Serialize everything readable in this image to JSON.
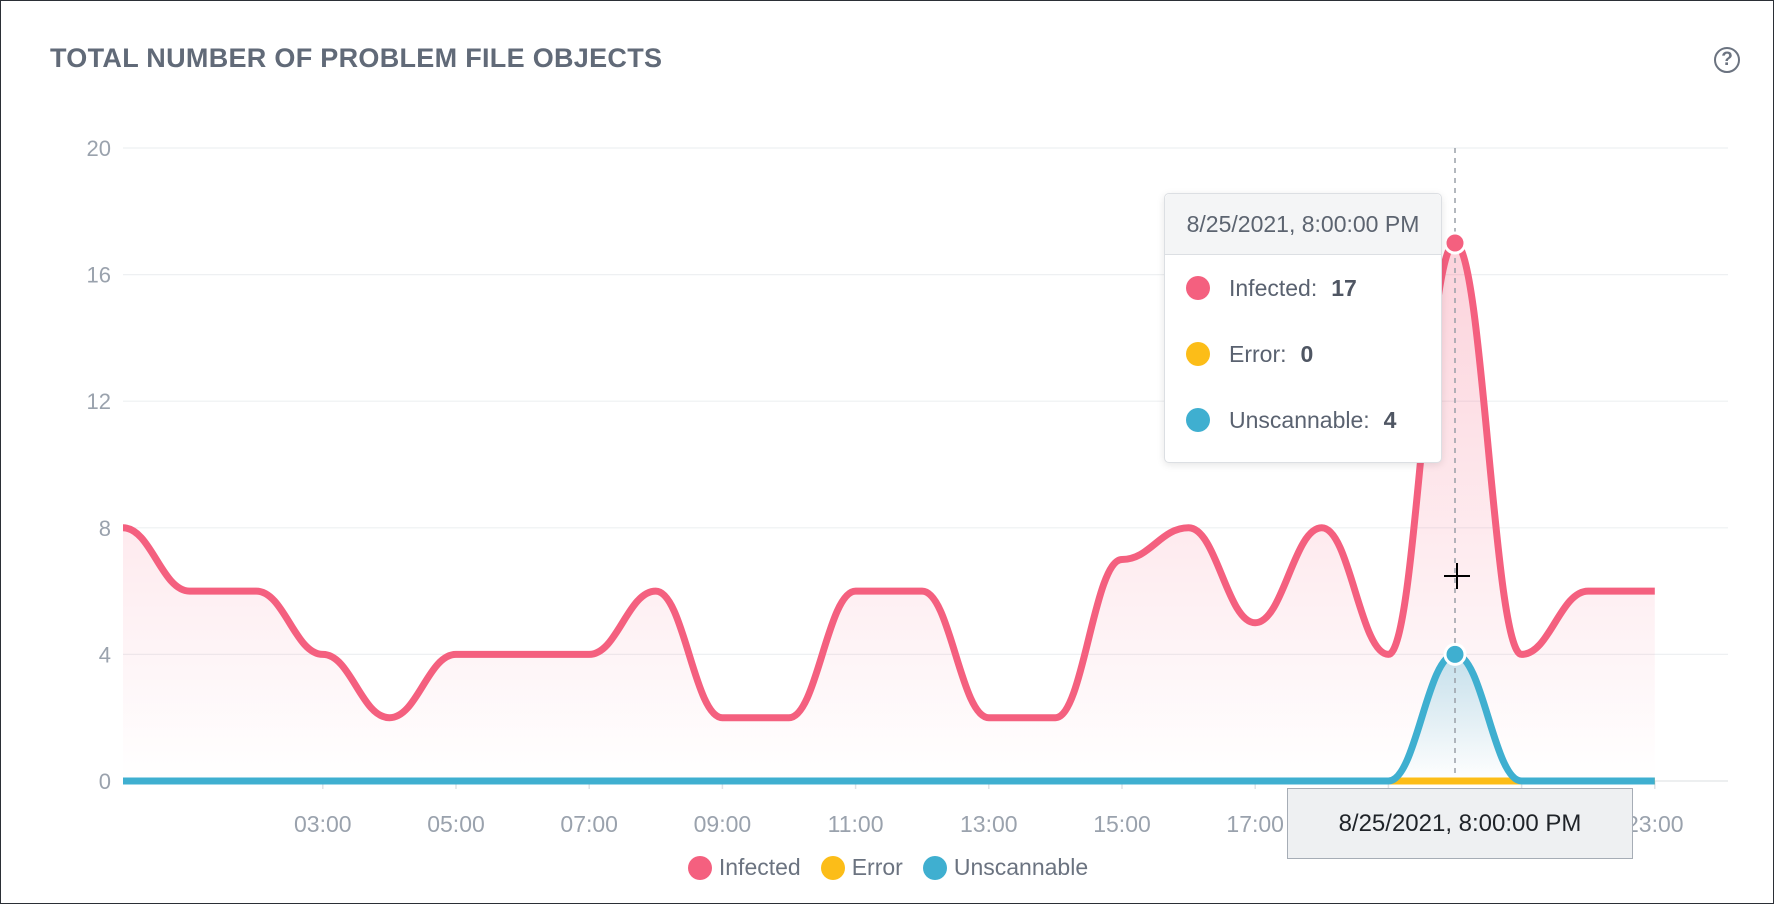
{
  "title": "TOTAL NUMBER OF PROBLEM FILE OBJECTS",
  "help_glyph": "?",
  "colors": {
    "infected": "#f4607f",
    "error": "#fcbd18",
    "unscannable": "#3fafd0",
    "grid": "#eef0f2",
    "axis_text": "#9aa2ad"
  },
  "tooltip": {
    "header": "8/25/2021, 8:00:00 PM",
    "rows": [
      {
        "label": "Infected:",
        "value": "17"
      },
      {
        "label": "Error:",
        "value": "0"
      },
      {
        "label": "Unscannable:",
        "value": "4"
      }
    ]
  },
  "hover_x_label": "8/25/2021, 8:00:00 PM",
  "legend": {
    "items": [
      {
        "label": "Infected"
      },
      {
        "label": "Error"
      },
      {
        "label": "Unscannable"
      }
    ]
  },
  "chart_data": {
    "type": "area",
    "title": "TOTAL NUMBER OF PROBLEM FILE OBJECTS",
    "x_hours": [
      0,
      1,
      2,
      3,
      4,
      5,
      6,
      7,
      8,
      9,
      10,
      11,
      12,
      13,
      14,
      15,
      16,
      17,
      18,
      19,
      20,
      21,
      22,
      23
    ],
    "x_tick_labels": [
      "03:00",
      "05:00",
      "07:00",
      "09:00",
      "11:00",
      "13:00",
      "15:00",
      "17:00",
      "19:00",
      "21:00",
      "23:00"
    ],
    "x_tick_hours": [
      3,
      5,
      7,
      9,
      11,
      13,
      15,
      17,
      19,
      21,
      23
    ],
    "ylim": [
      0,
      20
    ],
    "y_ticks": [
      0,
      4,
      8,
      12,
      16,
      20
    ],
    "grid": true,
    "legend_position": "bottom-center",
    "highlighted_hour": 20,
    "series": [
      {
        "name": "Infected",
        "values": [
          8,
          6,
          6,
          4,
          2,
          4,
          4,
          4,
          6,
          2,
          2,
          6,
          6,
          2,
          2,
          7,
          8,
          5,
          8,
          4,
          17,
          4,
          6,
          6
        ]
      },
      {
        "name": "Error",
        "values": [
          0,
          0,
          0,
          0,
          0,
          0,
          0,
          0,
          0,
          0,
          0,
          0,
          0,
          0,
          0,
          0,
          0,
          0,
          0,
          0,
          0,
          0,
          0,
          0
        ]
      },
      {
        "name": "Unscannable",
        "values": [
          0,
          0,
          0,
          0,
          0,
          0,
          0,
          0,
          0,
          0,
          0,
          0,
          0,
          0,
          0,
          0,
          0,
          0,
          0,
          0,
          4,
          0,
          0,
          0
        ]
      }
    ]
  }
}
